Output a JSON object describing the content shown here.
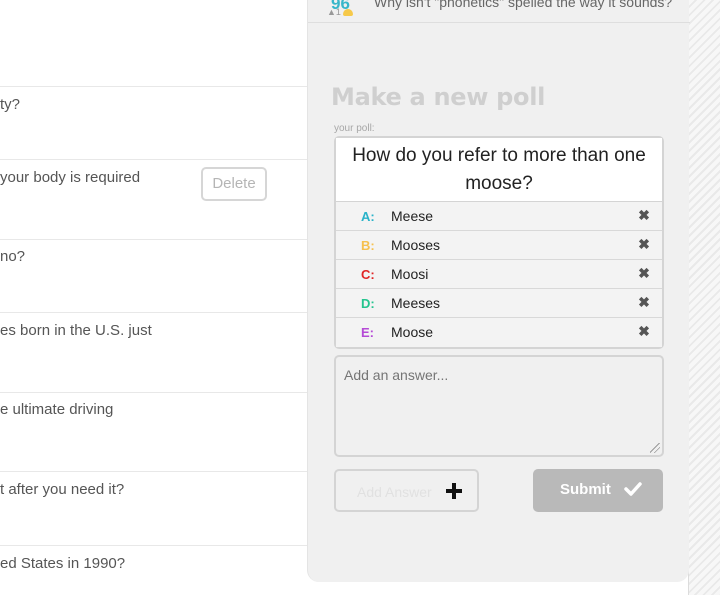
{
  "left_list": {
    "questions": [
      "ty?",
      "your body is required",
      "no?",
      "es born in the U.S. just",
      "e ultimate driving",
      "t after you need it?",
      "ed States in 1990?"
    ],
    "delete_label": "Delete"
  },
  "top_item": {
    "votes": "96",
    "question": "Why isn't \"phonetics\" spelled the way it sounds?",
    "meta": "▲1"
  },
  "panel": {
    "title": "Make a new poll",
    "your_poll_label": "your poll:",
    "question": "How do you refer to more than one moose?",
    "answers": [
      {
        "letter": "A:",
        "text": "Meese",
        "color": "#29b3c9"
      },
      {
        "letter": "B:",
        "text": "Mooses",
        "color": "#f6c04f"
      },
      {
        "letter": "C:",
        "text": "Moosi",
        "color": "#e02424"
      },
      {
        "letter": "D:",
        "text": "Meeses",
        "color": "#24c48e"
      },
      {
        "letter": "E:",
        "text": "Moose",
        "color": "#b54ad6"
      }
    ],
    "remove_icon": "✖",
    "add_answer_placeholder": "Add an answer...",
    "add_answer_button": "Add Answer",
    "submit_button": "Submit"
  },
  "icons": {
    "plus": "plus-icon",
    "check": "check-icon",
    "remove": "close-icon",
    "cloud": "cloud-icon"
  }
}
